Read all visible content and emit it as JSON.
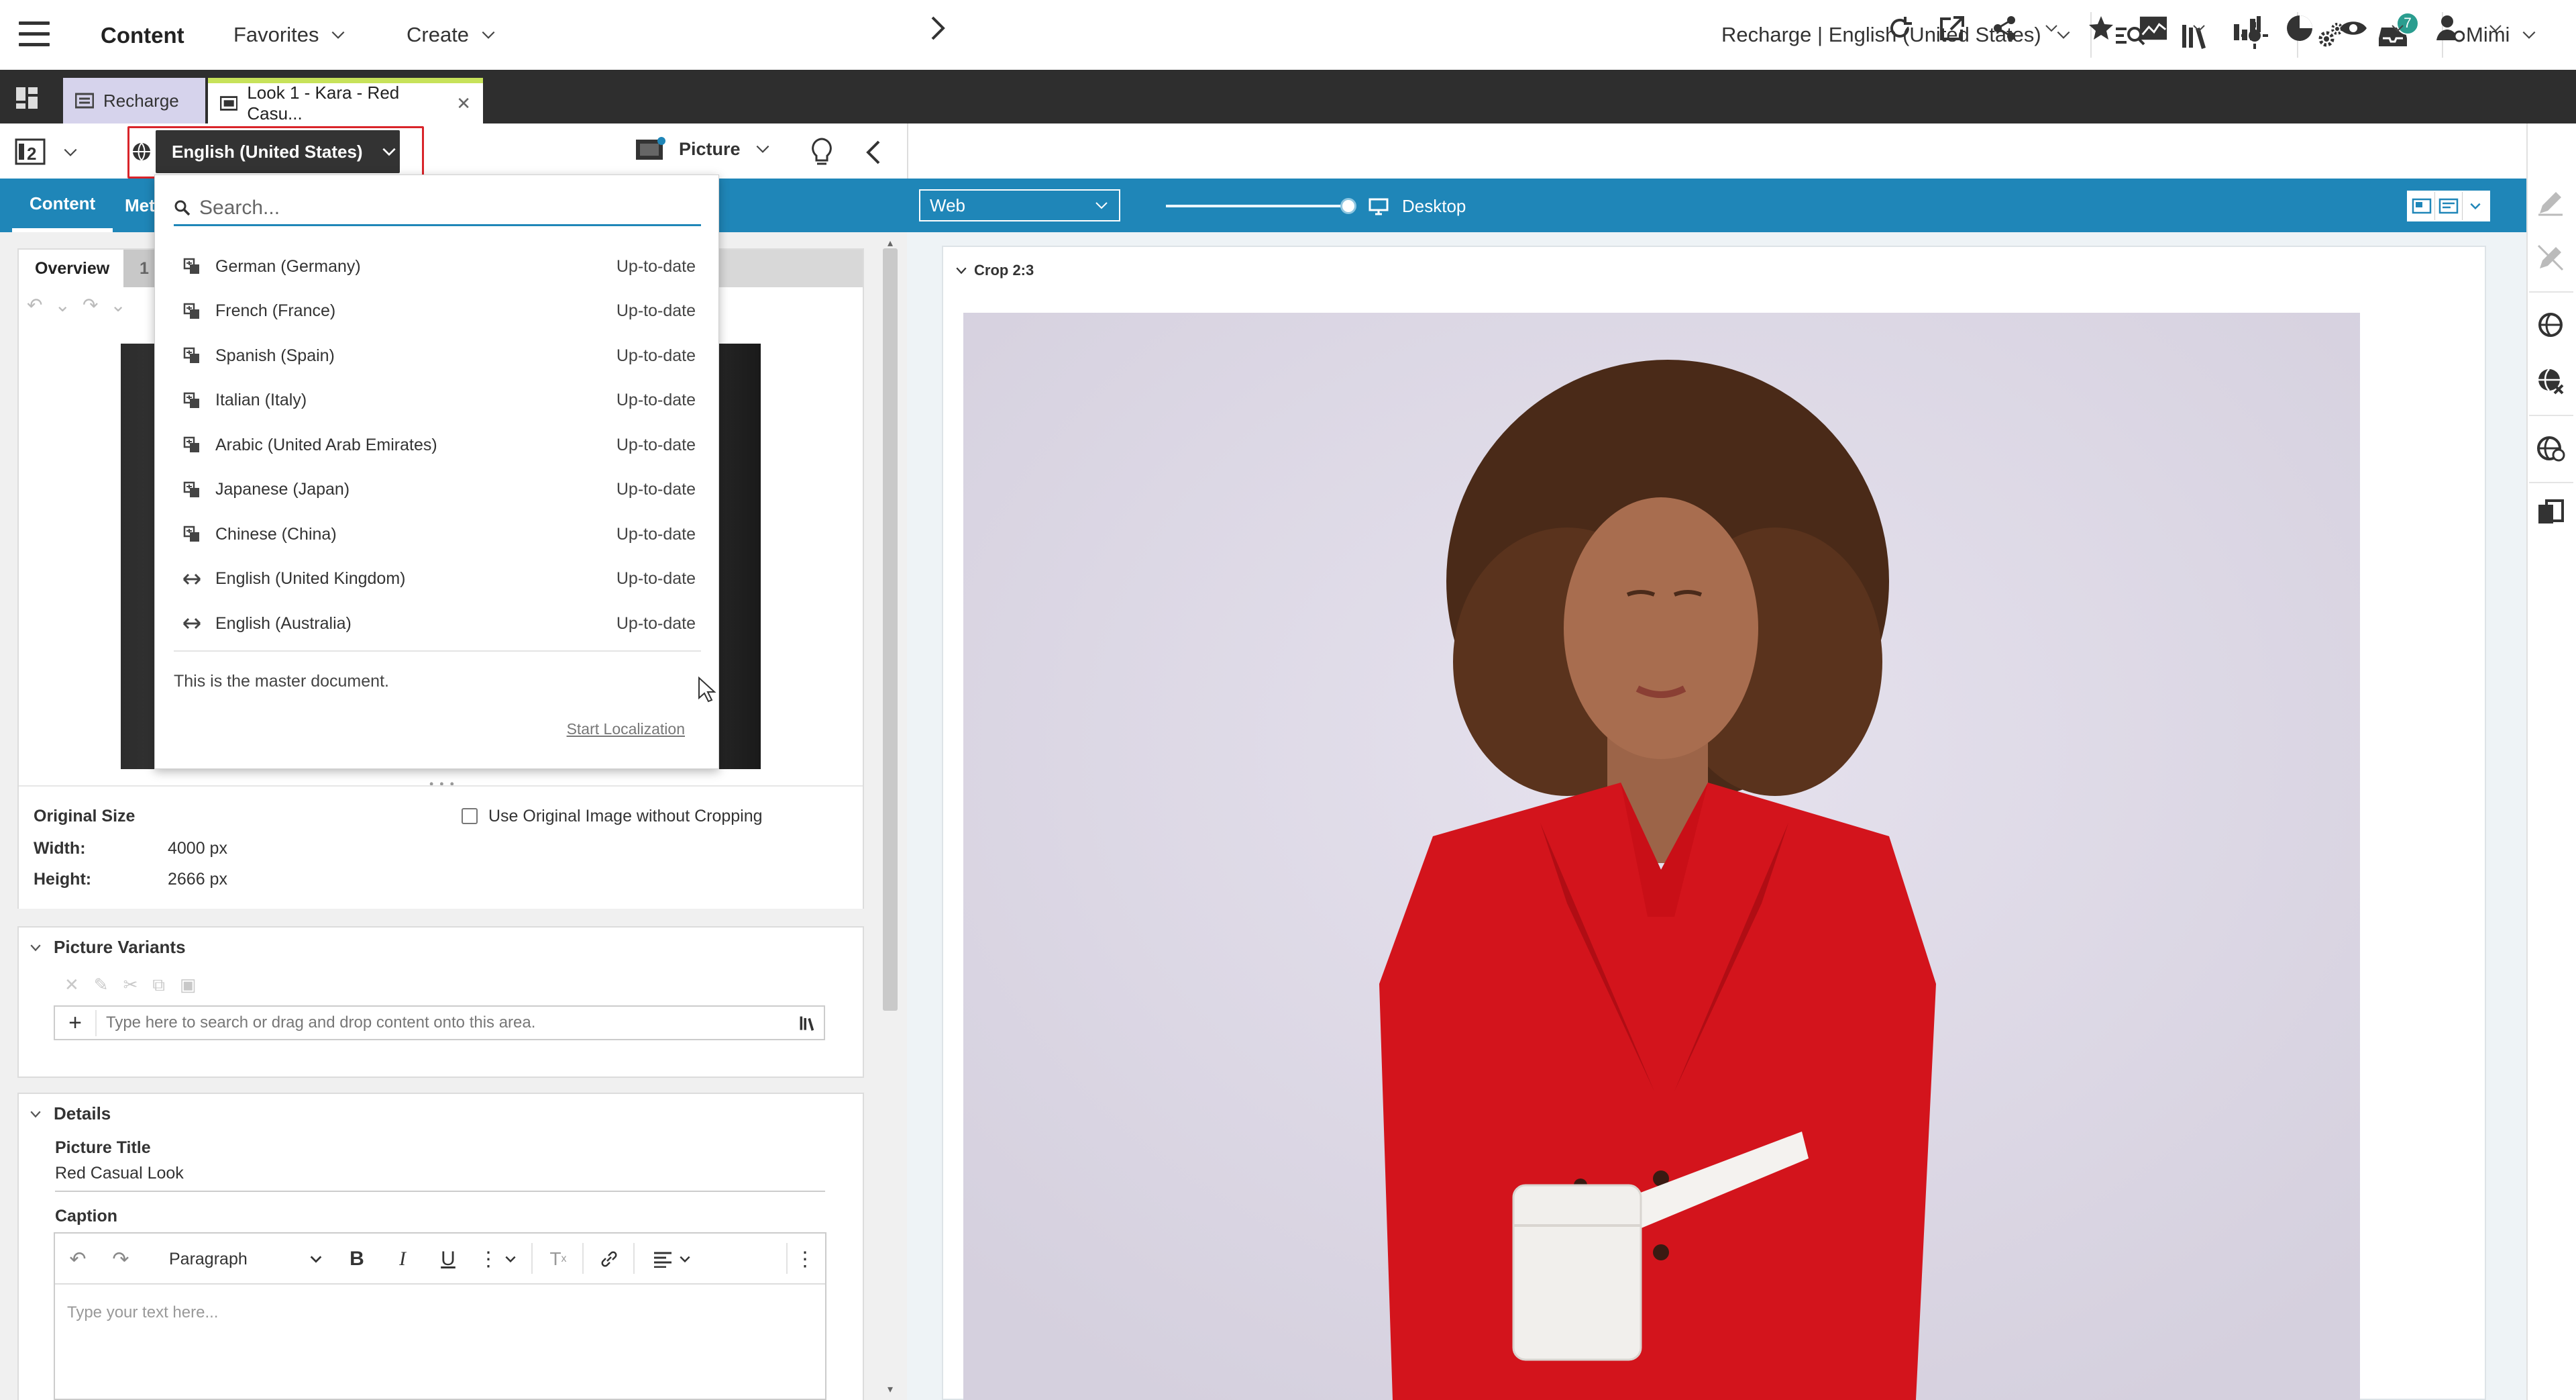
{
  "topbar": {
    "app_title": "Content",
    "favorites_label": "Favorites",
    "create_label": "Create",
    "site_selector": "Recharge | English (United States)",
    "notification_count": "7",
    "user_name": "Mimi"
  },
  "tabs": [
    {
      "label": "Recharge"
    },
    {
      "label": "Look 1 - Kara - Red Casu..."
    }
  ],
  "left_toolbar": {
    "locale_button": "English (United States)",
    "doc_type": "Picture"
  },
  "left_subtabs": [
    {
      "label": "Content"
    },
    {
      "label": "Met"
    }
  ],
  "editor": {
    "overview_tab": "Overview",
    "other_tab": "1"
  },
  "locale_dropdown": {
    "search_placeholder": "Search...",
    "items": [
      {
        "label": "German (Germany)",
        "status": "Up-to-date",
        "icon": "translate-icon"
      },
      {
        "label": "French (France)",
        "status": "Up-to-date",
        "icon": "translate-icon"
      },
      {
        "label": "Spanish (Spain)",
        "status": "Up-to-date",
        "icon": "translate-icon"
      },
      {
        "label": "Italian (Italy)",
        "status": "Up-to-date",
        "icon": "translate-icon"
      },
      {
        "label": "Arabic (United Arab Emirates)",
        "status": "Up-to-date",
        "icon": "translate-icon"
      },
      {
        "label": "Japanese (Japan)",
        "status": "Up-to-date",
        "icon": "translate-icon"
      },
      {
        "label": "Chinese (China)",
        "status": "Up-to-date",
        "icon": "translate-icon"
      },
      {
        "label": "English (United Kingdom)",
        "status": "Up-to-date",
        "icon": "derive-icon"
      },
      {
        "label": "English (Australia)",
        "status": "Up-to-date",
        "icon": "derive-icon"
      }
    ],
    "master_note": "This is the master document.",
    "start_localization": "Start Localization"
  },
  "image_meta": {
    "original_size_label": "Original Size",
    "use_original_label": "Use Original Image without Cropping",
    "width_label": "Width:",
    "width_value": "4000 px",
    "height_label": "Height:",
    "height_value": "2666 px"
  },
  "picture_variants": {
    "title": "Picture Variants",
    "drop_placeholder": "Type here to search or drag and drop content onto this area."
  },
  "details": {
    "title": "Details",
    "picture_title_label": "Picture Title",
    "picture_title_value": "Red Casual Look",
    "caption_label": "Caption",
    "paragraph_style": "Paragraph",
    "caption_placeholder": "Type your text here..."
  },
  "preview": {
    "channel": "Web",
    "device": "Desktop",
    "crop_label": "Crop 2:3"
  },
  "colors": {
    "accent_blue": "#1f86b8",
    "dark_bar": "#2e2e2e",
    "highlight_red": "#d9242a",
    "badge_teal": "#2a9d8f",
    "jacket_red": "#d3141c"
  }
}
